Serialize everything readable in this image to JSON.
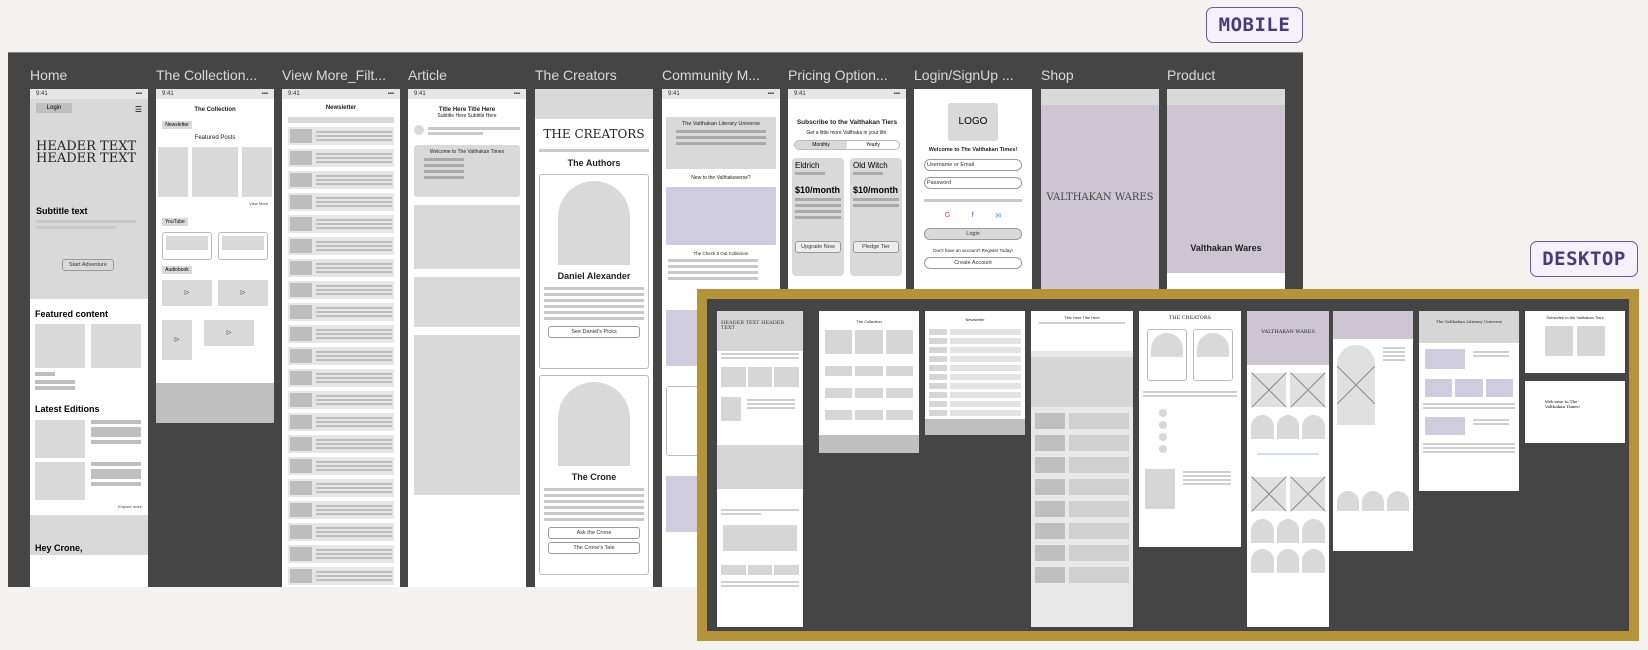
{
  "tags": {
    "mobile": "MOBILE",
    "desktop": "DESKTOP"
  },
  "mobile_frames": [
    {
      "label": "Home"
    },
    {
      "label": "The Collection..."
    },
    {
      "label": "View More_Filt..."
    },
    {
      "label": "Article"
    },
    {
      "label": "The Creators"
    },
    {
      "label": "Community M..."
    },
    {
      "label": "Pricing Option..."
    },
    {
      "label": "Login/SignUp ..."
    },
    {
      "label": "Shop"
    },
    {
      "label": "Product"
    }
  ],
  "status_time": "9:41",
  "home": {
    "login": "Login",
    "header": "HEADER TEXT HEADER TEXT",
    "subtitle": "Subtitle text",
    "start": "Start Adventure",
    "featured": "Featured content",
    "latest": "Latest Editions",
    "explore": "Explore more",
    "hey": "Hey Crone,"
  },
  "collection": {
    "title": "The Collection",
    "newsletter": "Newsletter",
    "featured": "Featured Posts",
    "view_more": "View More",
    "youtube": "YouTube",
    "audiobook": "Audiobook"
  },
  "newsletter": {
    "title": "Newsletter"
  },
  "article": {
    "title": "Title Here Title Here",
    "subtitle": "Subtitle Here Subtitle Here",
    "welcome": "Welcome to The Valthakan Times"
  },
  "creators": {
    "title": "THE CREATORS",
    "authors": "The Authors",
    "name1": "Daniel Alexander",
    "btn1": "See Daniel's Picks",
    "name2": "The Crone",
    "btn2": "Ask the Crone",
    "btn3": "The Crone's Tale"
  },
  "community": {
    "title": "The Valthakan Literary Universe",
    "new_to": "New to the Valthakaverse?",
    "check": "The Check It Out Collection"
  },
  "pricing": {
    "title": "Subscribe to the Valthakan Tiers",
    "sub": "Get a little more Valthaka in your life.",
    "monthly": "Monthly",
    "yearly": "Yearly",
    "tier1": "Eldrich",
    "tier2": "Old Witch",
    "price": "$10/month",
    "upgrade": "Upgrade Now",
    "pledge": "Pledge Tier"
  },
  "login": {
    "logo": "LOGO",
    "welcome": "Welcome to The Valthakan Times!",
    "user": "Username or Email",
    "pass": "Password",
    "login": "Login",
    "register": "Don't have an account? Register Today!",
    "create": "Create Account"
  },
  "shop": {
    "brand": "VALTHAKAN WARES"
  },
  "product": {
    "brand": "Valthakan Wares"
  }
}
